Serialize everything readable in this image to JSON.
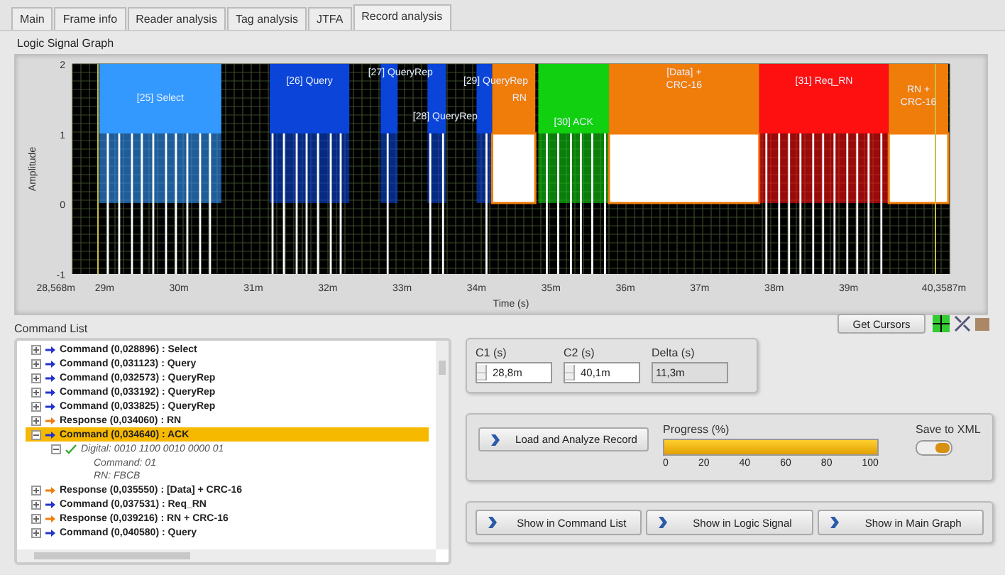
{
  "tabs": [
    {
      "label": "Main",
      "selected": false
    },
    {
      "label": "Frame info",
      "selected": false
    },
    {
      "label": "Reader analysis",
      "selected": false
    },
    {
      "label": "Tag analysis",
      "selected": false
    },
    {
      "label": "JTFA",
      "selected": false
    },
    {
      "label": "Record analysis",
      "selected": true
    }
  ],
  "graph": {
    "title": "Logic Signal Graph",
    "ylabel": "Amplitude",
    "xlabel": "Time (s)",
    "yticks": [
      "2",
      "1",
      "0",
      "-1"
    ],
    "xticks": [
      "28,568m",
      "29m",
      "30m",
      "31m",
      "32m",
      "33m",
      "34m",
      "35m",
      "36m",
      "37m",
      "38m",
      "39m",
      "40,3587m"
    ],
    "segments": [
      {
        "kind": "command",
        "label": "[25] Select",
        "color": "#3399ff"
      },
      {
        "kind": "command",
        "label": "[26] Query",
        "color": "#0a44d8"
      },
      {
        "kind": "command",
        "label": "[27] QueryRep",
        "color": "#0a44d8"
      },
      {
        "kind": "command",
        "label": "[28] QueryRep",
        "color": "#0a44d8"
      },
      {
        "kind": "command",
        "label": "[29] QueryRep",
        "color": "#0a44d8"
      },
      {
        "kind": "response",
        "label": "RN",
        "color": "#f07c0a"
      },
      {
        "kind": "command",
        "label": "[30] ACK",
        "color": "#10d010"
      },
      {
        "kind": "response",
        "label": "[Data] + CRC-16",
        "color": "#f07c0a"
      },
      {
        "kind": "command",
        "label": "[31] Req_RN",
        "color": "#ff1010"
      },
      {
        "kind": "response",
        "label": "RN + CRC-16",
        "color": "#f07c0a"
      }
    ]
  },
  "command_list": {
    "title": "Command List",
    "items": [
      {
        "kind": "command",
        "text": "Command (0,028896) : Select",
        "selected": false,
        "expanded": false
      },
      {
        "kind": "command",
        "text": "Command (0,031123) : Query",
        "selected": false,
        "expanded": false
      },
      {
        "kind": "command",
        "text": "Command (0,032573) : QueryRep",
        "selected": false,
        "expanded": false
      },
      {
        "kind": "command",
        "text": "Command (0,033192) : QueryRep",
        "selected": false,
        "expanded": false
      },
      {
        "kind": "command",
        "text": "Command (0,033825) : QueryRep",
        "selected": false,
        "expanded": false
      },
      {
        "kind": "response",
        "text": "Response (0,034060) : RN",
        "selected": false,
        "expanded": false
      },
      {
        "kind": "command",
        "text": "Command (0,034640) : ACK",
        "selected": true,
        "expanded": true,
        "children": [
          {
            "kind": "detail",
            "text": "Digital: 0010 1100 0010 0000 01",
            "selected": false,
            "expanded": true,
            "children": [
              {
                "kind": "field",
                "text": "Command: 01",
                "selected": false
              },
              {
                "kind": "field",
                "text": "RN: FBCB",
                "selected": false
              }
            ]
          }
        ]
      },
      {
        "kind": "response",
        "text": "Response (0,035550) : [Data] + CRC-16",
        "selected": false,
        "expanded": false
      },
      {
        "kind": "command",
        "text": "Command (0,037531) : Req_RN",
        "selected": false,
        "expanded": false
      },
      {
        "kind": "response",
        "text": "Response (0,039216) : RN + CRC-16",
        "selected": false,
        "expanded": false
      },
      {
        "kind": "command",
        "text": "Command (0,040580) : Query",
        "selected": false,
        "expanded": false
      }
    ]
  },
  "get_cursors": "Get Cursors",
  "cursors": [
    {
      "label": "C1 (s)",
      "value": "28,8m",
      "kind": "spin"
    },
    {
      "label": "C2 (s)",
      "value": "40,1m",
      "kind": "spin"
    },
    {
      "label": "Delta (s)",
      "value": "11,3m",
      "kind": "readout"
    }
  ],
  "load_button": "Load and Analyze Record",
  "progress": {
    "label": "Progress (%)",
    "level": 1.0,
    "ticks": [
      "0",
      "20",
      "40",
      "60",
      "80",
      "100"
    ]
  },
  "save_xml": {
    "label": "Save to XML",
    "on": true
  },
  "show_buttons": [
    "Show in Command List",
    "Show in Logic Signal",
    "Show in Main Graph"
  ]
}
